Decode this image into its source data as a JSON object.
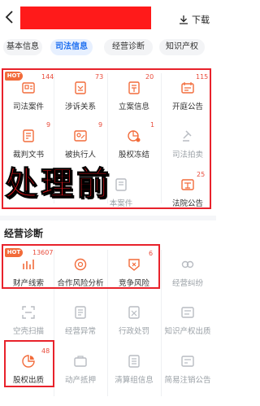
{
  "header": {
    "download_label": "下载"
  },
  "tabs": [
    {
      "label": "基本信息"
    },
    {
      "label": "司法信息"
    },
    {
      "label": "经营诊断"
    },
    {
      "label": "知识产权"
    }
  ],
  "judicial": {
    "items": [
      {
        "label": "司法案件",
        "icon": "case-icon",
        "count": "144",
        "hot": "HOT"
      },
      {
        "label": "涉诉关系",
        "icon": "relation-icon",
        "count": "73"
      },
      {
        "label": "立案信息",
        "icon": "filing-icon",
        "count": "20"
      },
      {
        "label": "开庭公告",
        "icon": "hearing-icon",
        "count": "115"
      },
      {
        "label": "裁判文书",
        "icon": "document-icon",
        "count": "9"
      },
      {
        "label": "被执行人",
        "icon": "executed-icon",
        "count": "9"
      },
      {
        "label": "股权冻结",
        "icon": "freeze-icon",
        "count": "1"
      },
      {
        "label": "司法拍卖",
        "icon": "auction-icon",
        "count": ""
      },
      {
        "label": "本案件",
        "icon": "case-small-icon",
        "count": ""
      },
      {
        "label": "法院公告",
        "icon": "court-notice-icon",
        "count": "25"
      }
    ]
  },
  "overlay_text": "处理前",
  "business": {
    "title": "经营诊断",
    "items": [
      {
        "label": "财产线索",
        "icon": "property-icon",
        "count": "13607",
        "hot": "HOT"
      },
      {
        "label": "合作风险分析",
        "icon": "risk-analysis-icon",
        "count": ""
      },
      {
        "label": "竞争风险",
        "icon": "competition-icon",
        "count": "6"
      },
      {
        "label": "经营纠纷",
        "icon": "dispute-icon",
        "count": ""
      },
      {
        "label": "空壳扫描",
        "icon": "scan-icon",
        "count": ""
      },
      {
        "label": "经营异常",
        "icon": "abnormal-icon",
        "count": ""
      },
      {
        "label": "行政处罚",
        "icon": "penalty-icon",
        "count": ""
      },
      {
        "label": "知识产权出质",
        "icon": "ip-pledge-icon",
        "count": ""
      },
      {
        "label": "股权出质",
        "icon": "equity-pledge-icon",
        "count": "48"
      },
      {
        "label": "动产抵押",
        "icon": "mortgage-icon",
        "count": ""
      },
      {
        "label": "清算组信息",
        "icon": "liquidation-icon",
        "count": ""
      },
      {
        "label": "简易注销公告",
        "icon": "cancel-icon",
        "count": ""
      }
    ]
  },
  "colors": {
    "accent": "#1e6ff0",
    "orange": "#f26b3a",
    "red": "#e8222b",
    "count": "#e94b3b"
  }
}
